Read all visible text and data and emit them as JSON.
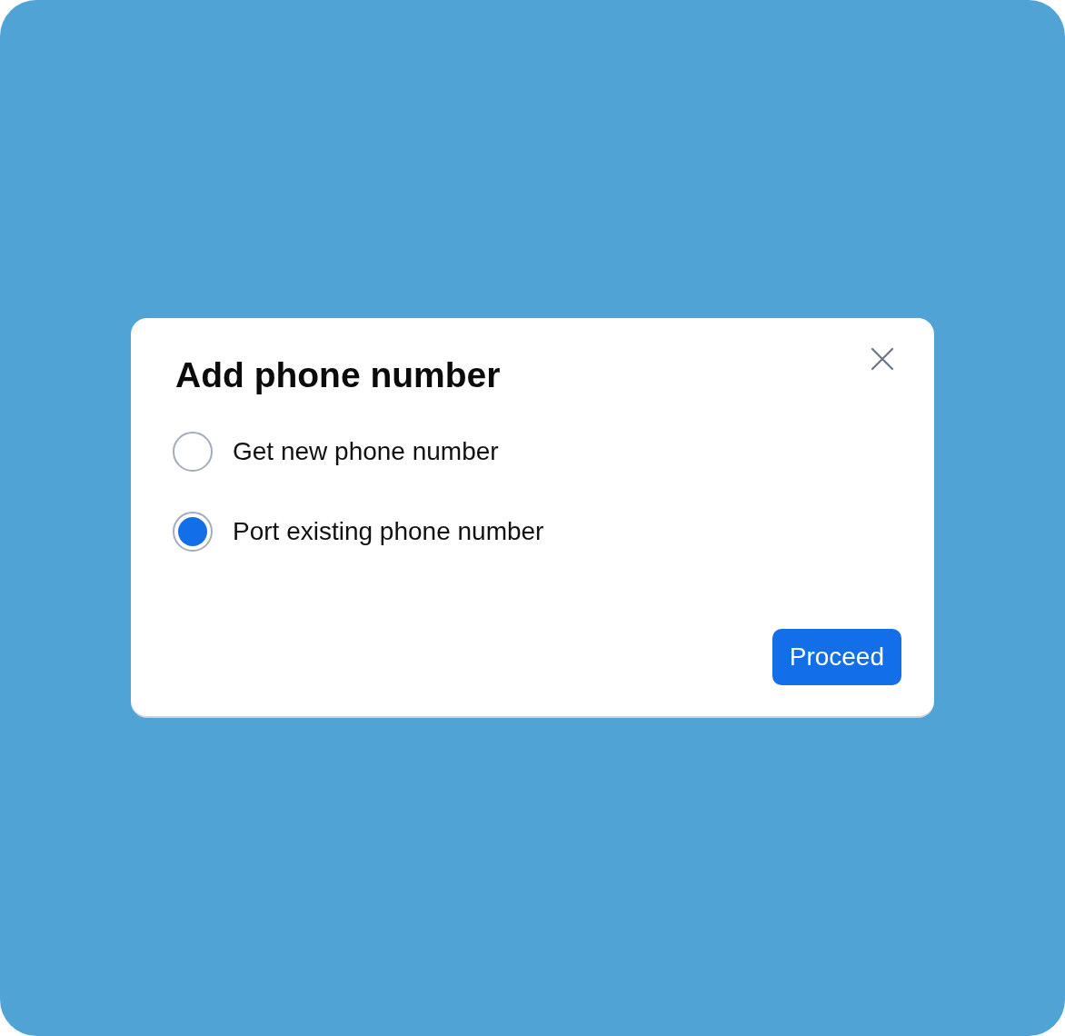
{
  "dialog": {
    "title": "Add phone number",
    "options": [
      {
        "label": "Get new phone number",
        "selected": false
      },
      {
        "label": "Port existing phone number",
        "selected": true
      }
    ],
    "buttons": [
      "Proceed"
    ]
  }
}
